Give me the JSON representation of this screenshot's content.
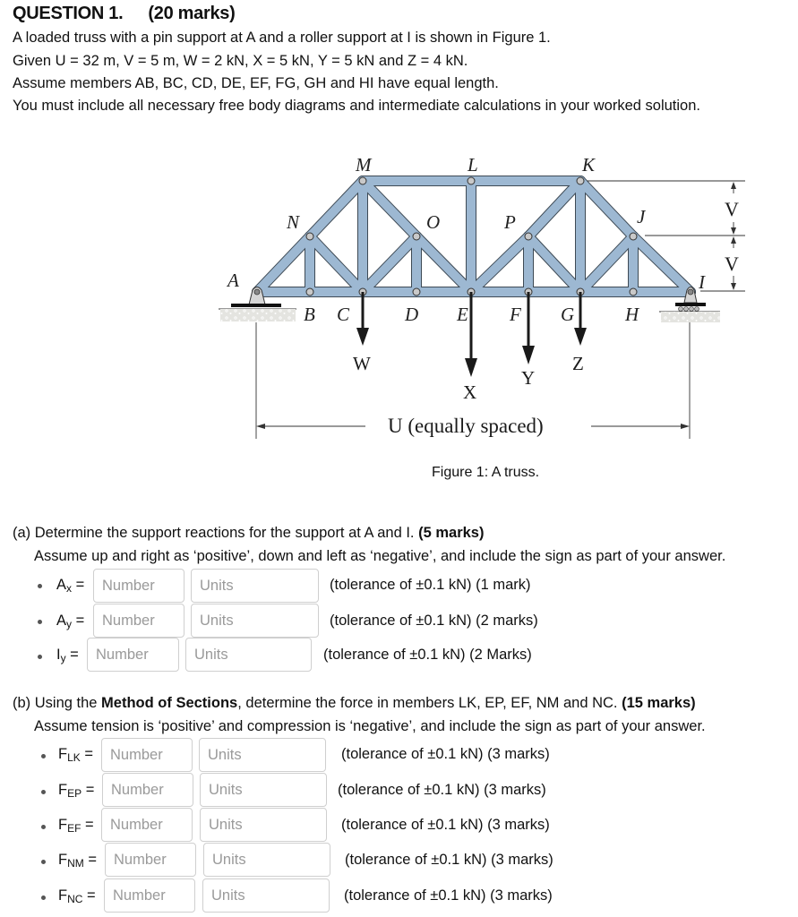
{
  "question": {
    "title": "QUESTION 1.",
    "marks": "(20 marks)",
    "lines": [
      "A loaded truss with a pin support at A and a roller support at I is shown in Figure 1.",
      "Given U = 32 m, V = 5 m, W = 2 kN, X = 5 kN, Y = 5 kN and Z = 4 kN.",
      "Assume members AB, BC, CD, DE, EF, FG, GH and HI have equal length.",
      "You must include all necessary free body diagrams and intermediate calculations in your worked solution."
    ]
  },
  "figure": {
    "caption": "Figure 1: A truss.",
    "colors": {
      "member": "#9db8d2",
      "member_edge": "#3e4a55",
      "arrow": "#1a1a1a"
    },
    "node_labels": {
      "A": "A",
      "B": "B",
      "C": "C",
      "D": "D",
      "E": "E",
      "F": "F",
      "G": "G",
      "H": "H",
      "I": "I",
      "J": "J",
      "K": "K",
      "L": "L",
      "M": "M",
      "N": "N",
      "O": "O",
      "P": "P"
    },
    "loads": {
      "W": "W",
      "X": "X",
      "Y": "Y",
      "Z": "Z"
    },
    "dimension_v_top": "V",
    "dimension_v_bottom": "V",
    "dimension_u": "U (equally spaced)"
  },
  "part_a": {
    "prefix": "(a) Determine the support reactions for the support at A and I. ",
    "marks": "(5 marks)",
    "instruction": "Assume up and right as ‘positive’, down and left as ‘negative’, and include the sign as part of your answer.",
    "items": [
      {
        "symbol": "A",
        "sub": "x",
        "number_value": "",
        "number_placeholder": "Number",
        "units_value": "",
        "units_placeholder": "Units",
        "tolerance": "(tolerance of ±0.1 kN) (1 mark)"
      },
      {
        "symbol": "A",
        "sub": "y",
        "number_value": "",
        "number_placeholder": "Number",
        "units_value": "",
        "units_placeholder": "Units",
        "tolerance": "(tolerance of ±0.1 kN) (2 marks)"
      },
      {
        "symbol": "I",
        "sub": "y",
        "number_value": "",
        "number_placeholder": "Number",
        "units_value": "",
        "units_placeholder": "Units",
        "tolerance": "(tolerance of ±0.1 kN) (2 Marks)"
      }
    ]
  },
  "part_b": {
    "prefix": "(b) Using the ",
    "method": "Method of Sections",
    "middle": ", determine the force in members LK, EP, EF, NM and NC. ",
    "marks": "(15 marks)",
    "instruction": "Assume tension is ‘positive’ and compression is ‘negative’, and include the sign as part of your answer.",
    "items": [
      {
        "symbol": "F",
        "sub": "LK",
        "number_value": "",
        "number_placeholder": "Number",
        "units_value": "",
        "units_placeholder": "Units",
        "tolerance": "(tolerance of ±0.1 kN) (3 marks)"
      },
      {
        "symbol": "F",
        "sub": "EP",
        "number_value": "",
        "number_placeholder": "Number",
        "units_value": "",
        "units_placeholder": "Units",
        "tolerance": "(tolerance of ±0.1 kN) (3 marks)"
      },
      {
        "symbol": "F",
        "sub": "EF",
        "number_value": "",
        "number_placeholder": "Number",
        "units_value": "",
        "units_placeholder": "Units",
        "tolerance": "(tolerance of ±0.1 kN) (3 marks)"
      },
      {
        "symbol": "F",
        "sub": "NM",
        "number_value": "",
        "number_placeholder": "Number",
        "units_value": "",
        "units_placeholder": "Units",
        "tolerance": "(tolerance of ±0.1 kN) (3 marks)"
      },
      {
        "symbol": "F",
        "sub": "NC",
        "number_value": "",
        "number_placeholder": "Number",
        "units_value": "",
        "units_placeholder": "Units",
        "tolerance": "(tolerance of ±0.1 kN) (3 marks)"
      }
    ]
  }
}
